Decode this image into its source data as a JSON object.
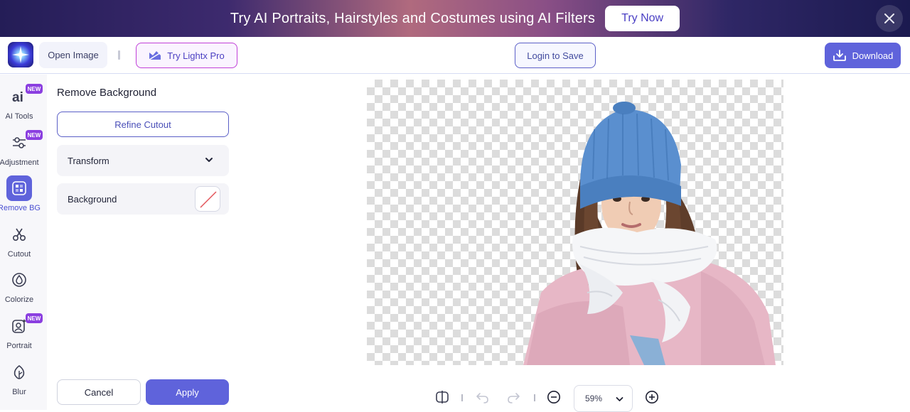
{
  "banner": {
    "text": "Try AI Portraits, Hairstyles and Costumes using AI Filters",
    "cta": "Try Now"
  },
  "topbar": {
    "open_image": "Open Image",
    "try_pro": "Try Lightx Pro",
    "login": "Login to Save",
    "download": "Download"
  },
  "sidebar": {
    "tools": [
      {
        "label": "AI Tools",
        "icon": "ai-icon",
        "badge": "NEW",
        "active": false
      },
      {
        "label": "Adjustment",
        "icon": "sliders-icon",
        "badge": "NEW",
        "active": false
      },
      {
        "label": "Remove BG",
        "icon": "remove-bg-icon",
        "badge": "",
        "active": true
      },
      {
        "label": "Cutout",
        "icon": "scissors-icon",
        "badge": "",
        "active": false
      },
      {
        "label": "Colorize",
        "icon": "drop-icon",
        "badge": "",
        "active": false
      },
      {
        "label": "Portrait",
        "icon": "portrait-icon",
        "badge": "NEW",
        "active": false
      },
      {
        "label": "Blur",
        "icon": "leaf-icon",
        "badge": "",
        "active": false
      }
    ]
  },
  "panel": {
    "title": "Remove Background",
    "refine": "Refine Cutout",
    "transform": "Transform",
    "background": "Background",
    "cancel": "Cancel",
    "apply": "Apply"
  },
  "bottom_bar": {
    "zoom": "59%"
  },
  "colors": {
    "accent": "#5f63db",
    "badge": "#8b3fe0",
    "pro_border": "#c03fd8"
  }
}
